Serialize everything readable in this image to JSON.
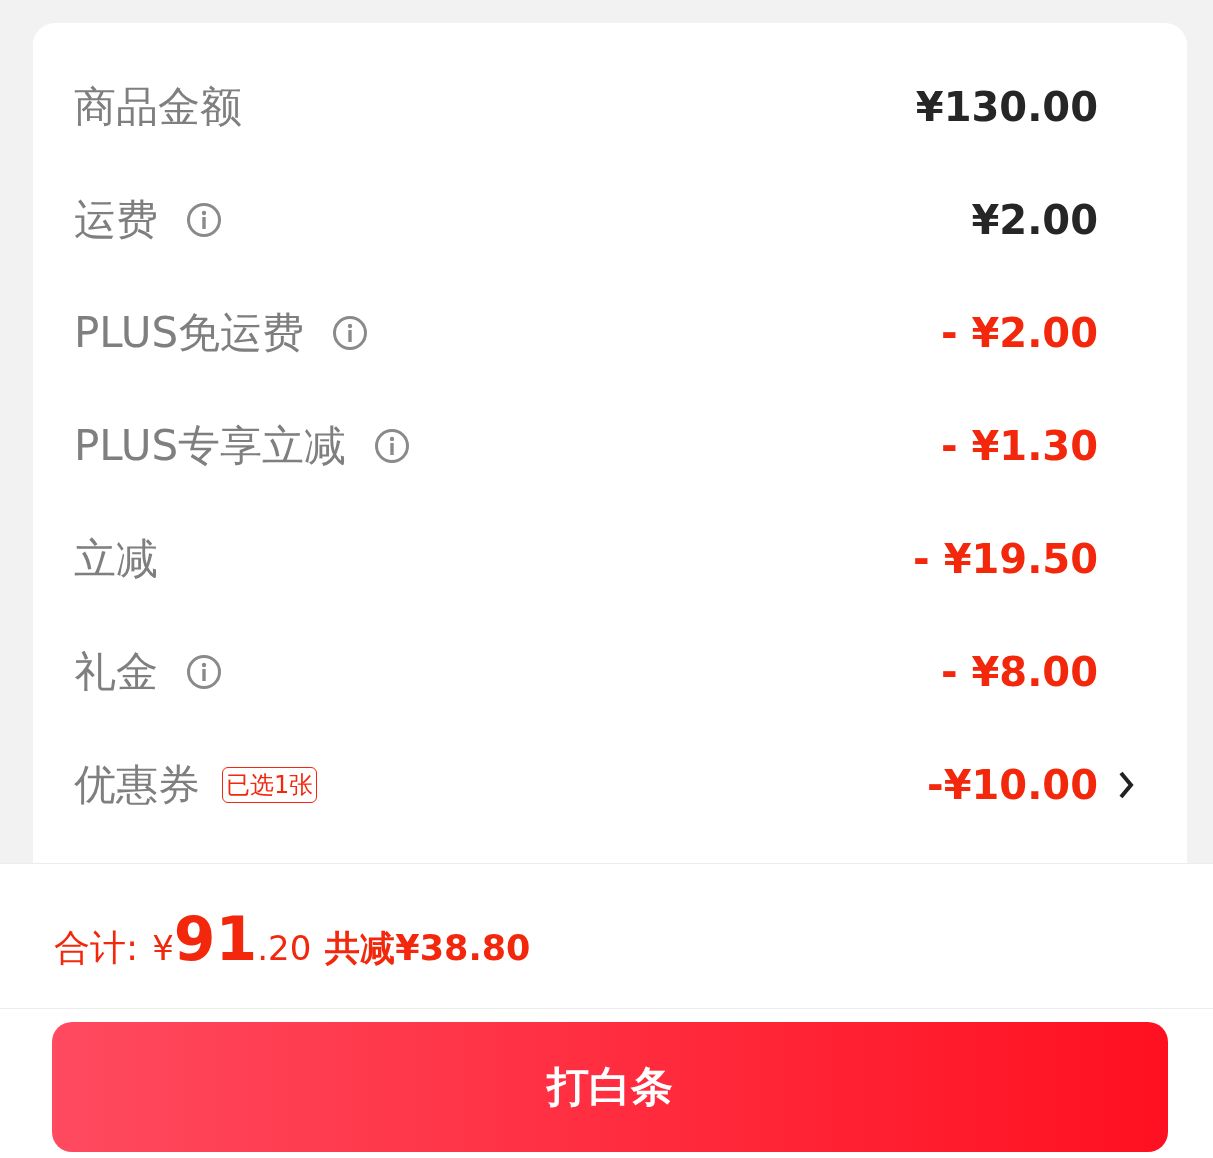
{
  "summary_rows": [
    {
      "label": "商品金额",
      "info": false,
      "kind": "charge",
      "value": "¥130.00"
    },
    {
      "label": "运费",
      "info": true,
      "kind": "charge",
      "value": "¥2.00"
    },
    {
      "label": "PLUS免运费",
      "info": true,
      "kind": "discount",
      "value": "- ¥2.00"
    },
    {
      "label": "PLUS专享立减",
      "info": true,
      "kind": "discount",
      "value": "- ¥1.30"
    },
    {
      "label": "立减",
      "info": false,
      "kind": "discount",
      "value": "- ¥19.50"
    },
    {
      "label": "礼金",
      "info": true,
      "kind": "discount",
      "value": "- ¥8.00"
    },
    {
      "label": "优惠券",
      "info": false,
      "badge": "已选1张",
      "kind": "discount",
      "value": "-¥10.00",
      "chevron": true
    }
  ],
  "footer": {
    "total_label": "合计:",
    "currency": "¥",
    "total_integer": "91",
    "total_decimal": ".20",
    "saved": "共减¥38.80"
  },
  "pay_button": "打白条"
}
